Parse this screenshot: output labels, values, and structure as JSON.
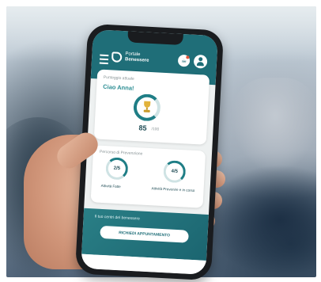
{
  "app": {
    "brand_line1": "Portale",
    "brand_line2": "Benessere"
  },
  "score_card": {
    "label": "Punteggio attuale",
    "greeting": "Ciao Anna!",
    "score": "85",
    "score_unit": "/100"
  },
  "progress_card": {
    "label": "Percorso di Prevenzione",
    "ring1_value": "2/5",
    "ring1_caption": "Attività Fatte",
    "ring2_value": "4/5",
    "ring2_caption": "Attività Prevenire e in corso"
  },
  "appointment": {
    "title": "Il tuo centri del benessere",
    "button_label": "RICHIEDI APPUNTAMENTO"
  },
  "colors": {
    "primary": "#1f6e78",
    "accent": "#2b8d93",
    "trophy": "#e2b33c"
  },
  "icons": [
    "menu-icon",
    "bell-icon",
    "user-icon",
    "trophy-icon"
  ]
}
